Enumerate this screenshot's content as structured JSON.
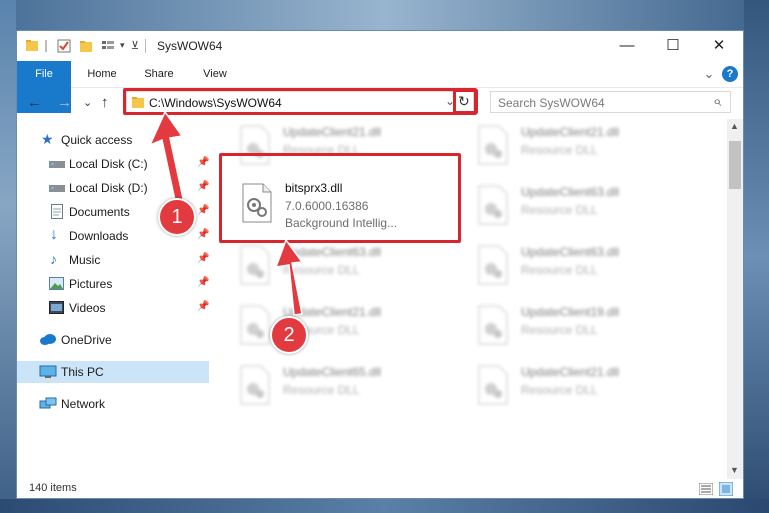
{
  "window": {
    "title": "SysWOW64",
    "minimize": "—",
    "maximize": "☐",
    "close": "✕"
  },
  "ribbon": {
    "tabs": [
      "File",
      "Home",
      "Share",
      "View"
    ],
    "expand": "⌄",
    "help": "?"
  },
  "nav": {
    "back": "←",
    "forward": "→",
    "recent": "⌄",
    "up": "↑",
    "address": "C:\\Windows\\SysWOW64",
    "address_dropdown": "⌄",
    "refresh": "↻",
    "search_placeholder": "Search SysWOW64",
    "search_icon": "⌕"
  },
  "sidebar": {
    "items": [
      {
        "label": "Quick access",
        "icon": "star-icon",
        "pinned": false
      },
      {
        "label": "Local Disk (C:)",
        "icon": "drive-icon",
        "pinned": true
      },
      {
        "label": "Local Disk (D:)",
        "icon": "drive-icon",
        "pinned": true
      },
      {
        "label": "Documents",
        "icon": "documents-icon",
        "pinned": true
      },
      {
        "label": "Downloads",
        "icon": "downloads-icon",
        "pinned": true
      },
      {
        "label": "Music",
        "icon": "music-icon",
        "pinned": true
      },
      {
        "label": "Pictures",
        "icon": "pictures-icon",
        "pinned": true
      },
      {
        "label": "Videos",
        "icon": "videos-icon",
        "pinned": true
      },
      {
        "label": "OneDrive",
        "icon": "cloud-icon",
        "pinned": false
      },
      {
        "label": "This PC",
        "icon": "computer-icon",
        "pinned": false,
        "selected": true
      },
      {
        "label": "Network",
        "icon": "network-icon",
        "pinned": false
      }
    ],
    "pin_glyph": "📌"
  },
  "files": [
    {
      "name": "UpdateClient21.dll",
      "sub": "Resource DLL",
      "blurred": true
    },
    {
      "name": "UpdateClient21.dll",
      "sub": "Resource DLL",
      "blurred": true
    },
    {
      "name": "bitsprx3.dll",
      "sub": "7.0.6000.16386",
      "sub2": "Background Intellig...",
      "blurred": false,
      "highlighted": true
    },
    {
      "name": "UpdateClient63.dll",
      "sub": "Resource DLL",
      "blurred": true
    },
    {
      "name": "UpdateClient63.dll",
      "sub": "Resource DLL",
      "blurred": true
    },
    {
      "name": "UpdateClient63.dll",
      "sub": "Resource DLL",
      "blurred": true
    },
    {
      "name": "UpdateClient21.dll",
      "sub": "Resource DLL",
      "blurred": true
    },
    {
      "name": "UpdateClient19.dll",
      "sub": "Resource DLL",
      "blurred": true
    },
    {
      "name": "UpdateClient65.dll",
      "sub": "Resource DLL",
      "blurred": true
    },
    {
      "name": "UpdateClient21.dll",
      "sub": "Resource DLL",
      "blurred": true
    }
  ],
  "annotations": {
    "step1": "1",
    "step2": "2",
    "color": "#d9262e"
  },
  "status": {
    "item_count": "140 items"
  },
  "colors": {
    "accent": "#1979ca",
    "selection": "#cce4f7"
  }
}
